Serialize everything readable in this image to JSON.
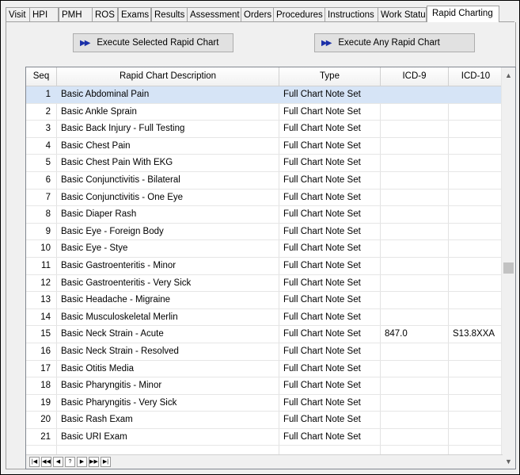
{
  "tabs": [
    {
      "label": "Visit"
    },
    {
      "label": "HPI"
    },
    {
      "label": "PMH"
    },
    {
      "label": "ROS"
    },
    {
      "label": "Exams"
    },
    {
      "label": "Results"
    },
    {
      "label": "Assessment"
    },
    {
      "label": "Orders"
    },
    {
      "label": "Procedures"
    },
    {
      "label": "Instructions"
    },
    {
      "label": "Work Status"
    },
    {
      "label": "Rapid Charting"
    }
  ],
  "active_tab": "Rapid Charting",
  "buttons": {
    "execute_selected": "Execute Selected Rapid Chart",
    "execute_any": "Execute Any Rapid Chart",
    "arrow_icon": "double-right-arrow-icon"
  },
  "grid": {
    "headers": {
      "seq": "Seq",
      "description": "Rapid Chart Description",
      "type": "Type",
      "icd9": "ICD-9",
      "icd10": "ICD-10"
    },
    "selected_seq": "1",
    "rows": [
      {
        "seq": "1",
        "description": "Basic Abdominal Pain",
        "type": "Full Chart Note Set",
        "icd9": "",
        "icd10": ""
      },
      {
        "seq": "2",
        "description": "Basic Ankle Sprain",
        "type": "Full Chart Note Set",
        "icd9": "",
        "icd10": ""
      },
      {
        "seq": "3",
        "description": "Basic Back Injury - Full Testing",
        "type": "Full Chart Note Set",
        "icd9": "",
        "icd10": ""
      },
      {
        "seq": "4",
        "description": "Basic Chest Pain",
        "type": "Full Chart Note Set",
        "icd9": "",
        "icd10": ""
      },
      {
        "seq": "5",
        "description": "Basic Chest Pain With EKG",
        "type": "Full Chart Note Set",
        "icd9": "",
        "icd10": ""
      },
      {
        "seq": "6",
        "description": "Basic Conjunctivitis - Bilateral",
        "type": "Full Chart Note Set",
        "icd9": "",
        "icd10": ""
      },
      {
        "seq": "7",
        "description": "Basic Conjunctivitis - One Eye",
        "type": "Full Chart Note Set",
        "icd9": "",
        "icd10": ""
      },
      {
        "seq": "8",
        "description": "Basic Diaper Rash",
        "type": "Full Chart Note Set",
        "icd9": "",
        "icd10": ""
      },
      {
        "seq": "9",
        "description": "Basic Eye - Foreign Body",
        "type": "Full Chart Note Set",
        "icd9": "",
        "icd10": ""
      },
      {
        "seq": "10",
        "description": "Basic Eye - Stye",
        "type": "Full Chart Note Set",
        "icd9": "",
        "icd10": ""
      },
      {
        "seq": "11",
        "description": "Basic Gastroenteritis - Minor",
        "type": "Full Chart Note Set",
        "icd9": "",
        "icd10": ""
      },
      {
        "seq": "12",
        "description": "Basic Gastroenteritis - Very Sick",
        "type": "Full Chart Note Set",
        "icd9": "",
        "icd10": ""
      },
      {
        "seq": "13",
        "description": "Basic Headache - Migraine",
        "type": "Full Chart Note Set",
        "icd9": "",
        "icd10": ""
      },
      {
        "seq": "14",
        "description": "Basic Musculoskeletal Merlin",
        "type": "Full Chart Note Set",
        "icd9": "",
        "icd10": ""
      },
      {
        "seq": "15",
        "description": "Basic Neck Strain - Acute",
        "type": "Full Chart Note Set",
        "icd9": "847.0",
        "icd10": "S13.8XXA"
      },
      {
        "seq": "16",
        "description": "Basic Neck Strain - Resolved",
        "type": "Full Chart Note Set",
        "icd9": "",
        "icd10": ""
      },
      {
        "seq": "17",
        "description": "Basic Otitis Media",
        "type": "Full Chart Note Set",
        "icd9": "",
        "icd10": ""
      },
      {
        "seq": "18",
        "description": "Basic Pharyngitis - Minor",
        "type": "Full Chart Note Set",
        "icd9": "",
        "icd10": ""
      },
      {
        "seq": "19",
        "description": "Basic Pharyngitis - Very Sick",
        "type": "Full Chart Note Set",
        "icd9": "",
        "icd10": ""
      },
      {
        "seq": "20",
        "description": "Basic Rash Exam",
        "type": "Full Chart Note Set",
        "icd9": "",
        "icd10": ""
      },
      {
        "seq": "21",
        "description": "Basic URI Exam",
        "type": "Full Chart Note Set",
        "icd9": "",
        "icd10": ""
      }
    ]
  },
  "navigator": {
    "buttons": [
      {
        "name": "first-page-icon",
        "glyph": "|◀"
      },
      {
        "name": "prior-page-icon",
        "glyph": "◀◀"
      },
      {
        "name": "prior-record-icon",
        "glyph": "◀"
      },
      {
        "name": "help-icon",
        "glyph": "?"
      },
      {
        "name": "next-record-icon",
        "glyph": "▶"
      },
      {
        "name": "next-page-icon",
        "glyph": "▶▶"
      },
      {
        "name": "last-page-icon",
        "glyph": "▶|"
      }
    ]
  },
  "scrollbar": {
    "up_glyph": "▲",
    "down_glyph": "▼"
  }
}
